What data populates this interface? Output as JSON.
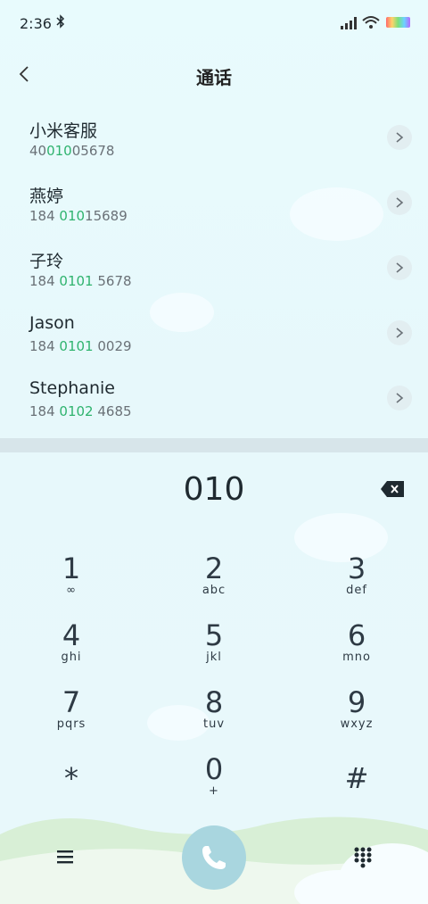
{
  "status_bar": {
    "time": "2:36",
    "bluetooth_icon": "bluetooth-icon"
  },
  "header": {
    "title": "通话"
  },
  "contacts": [
    {
      "name": "小米客服",
      "num_pre": "40",
      "num_hl": "010",
      "num_post": "05678"
    },
    {
      "name": "燕婷",
      "num_pre": "184 ",
      "num_hl": "010",
      "num_post": "15689"
    },
    {
      "name": "子玲",
      "num_pre": "184 ",
      "num_hl": "0101",
      "num_post": " 5678"
    },
    {
      "name": "Jason",
      "num_pre": "184 ",
      "num_hl": "0101",
      "num_post": " 0029"
    },
    {
      "name": "Stephanie",
      "num_pre": "184 ",
      "num_hl": "0102",
      "num_post": " 4685"
    }
  ],
  "dialer": {
    "entered": "010",
    "keys": [
      {
        "digit": "1",
        "letters": "∞"
      },
      {
        "digit": "2",
        "letters": "abc"
      },
      {
        "digit": "3",
        "letters": "def"
      },
      {
        "digit": "4",
        "letters": "ghi"
      },
      {
        "digit": "5",
        "letters": "jkl"
      },
      {
        "digit": "6",
        "letters": "mno"
      },
      {
        "digit": "7",
        "letters": "pqrs"
      },
      {
        "digit": "8",
        "letters": "tuv"
      },
      {
        "digit": "9",
        "letters": "wxyz"
      },
      {
        "digit": "*",
        "letters": ""
      },
      {
        "digit": "0",
        "letters": "+"
      },
      {
        "digit": "#",
        "letters": ""
      }
    ]
  },
  "colors": {
    "highlight": "#2fb36e",
    "call_button": "#a9d6df",
    "background": "#e8f9fc"
  }
}
